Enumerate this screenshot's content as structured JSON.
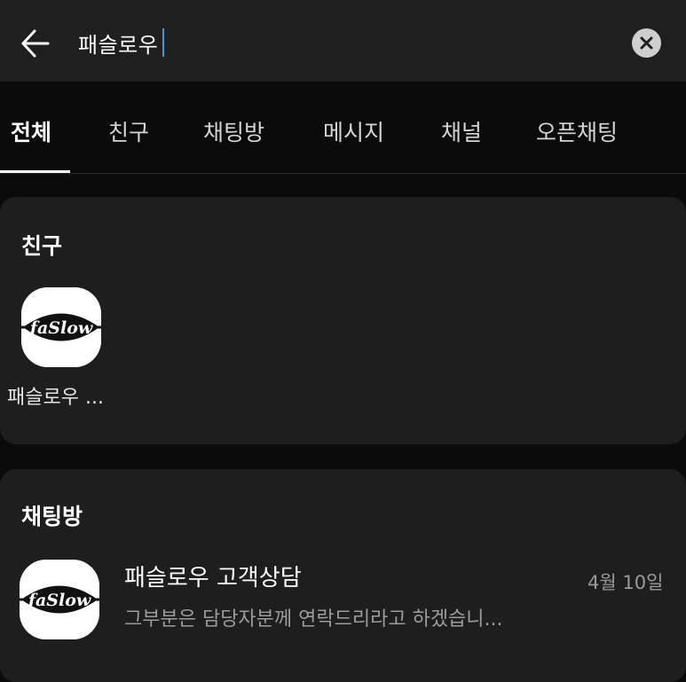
{
  "search": {
    "query": "패슬로우"
  },
  "tabs": [
    {
      "label": "전체",
      "active": true
    },
    {
      "label": "친구",
      "active": false
    },
    {
      "label": "채팅방",
      "active": false
    },
    {
      "label": "메시지",
      "active": false
    },
    {
      "label": "채널",
      "active": false
    },
    {
      "label": "오픈채팅",
      "active": false
    }
  ],
  "friends_section": {
    "title": "친구",
    "items": [
      {
        "name": "패슬로우 ...",
        "logo_text": "faSlow"
      }
    ]
  },
  "chats_section": {
    "title": "채팅방",
    "items": [
      {
        "title": "패슬로우 고객상담",
        "date": "4월 10일",
        "preview": "그부분은 담당자분께 연락드리라고 하겠습니...",
        "logo_text": "faSlow"
      }
    ]
  },
  "colors": {
    "background": "#0b0b0b",
    "card": "#1e1e1e",
    "topbar": "#1f1f1f",
    "caret": "#4a90e2"
  },
  "icons": {
    "back": "arrow-left-icon",
    "clear": "clear-circle-x-icon"
  }
}
